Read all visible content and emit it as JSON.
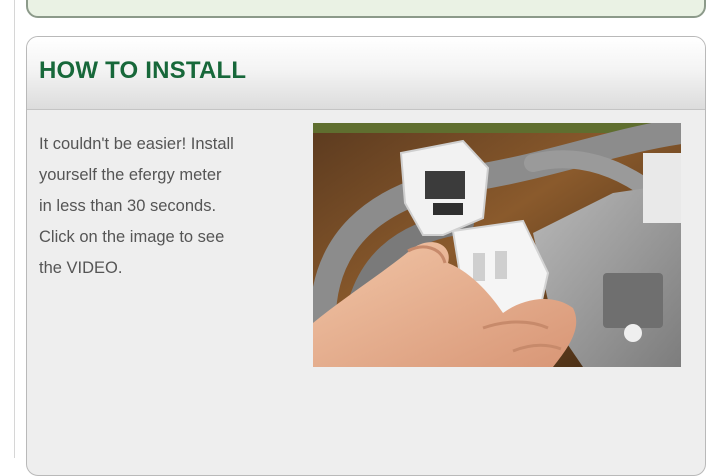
{
  "install_section": {
    "title": "HOW TO INSTALL",
    "text_lines": [
      "It couldn't be easier! Install",
      "yourself the efergy meter",
      "in less than 30 seconds.",
      "Click on the image to see",
      "the VIDEO."
    ],
    "video_thumbnail_icon": "video-thumbnail-image"
  },
  "colors": {
    "title_green": "#17683a",
    "text_gray": "#555555",
    "panel_bg": "#eeeeee",
    "top_panel_bg": "#eaf2e4"
  }
}
